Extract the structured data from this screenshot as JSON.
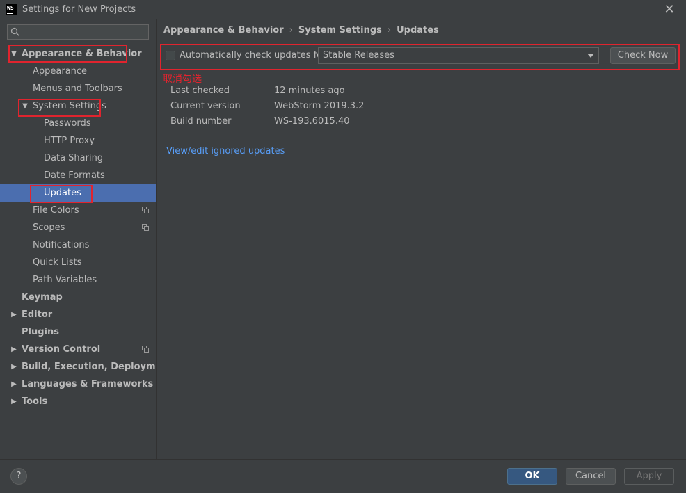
{
  "window": {
    "title": "Settings for New Projects",
    "app_logo": "WS"
  },
  "search": {
    "placeholder": "",
    "value": ""
  },
  "sidebar": {
    "appearance_behavior": "Appearance & Behavior",
    "appearance": "Appearance",
    "menus_toolbars": "Menus and Toolbars",
    "system_settings": "System Settings",
    "passwords": "Passwords",
    "http_proxy": "HTTP Proxy",
    "data_sharing": "Data Sharing",
    "date_formats": "Date Formats",
    "updates": "Updates",
    "file_colors": "File Colors",
    "scopes": "Scopes",
    "notifications": "Notifications",
    "quick_lists": "Quick Lists",
    "path_variables": "Path Variables",
    "keymap": "Keymap",
    "editor": "Editor",
    "plugins": "Plugins",
    "version_control": "Version Control",
    "build": "Build, Execution, Deployment",
    "languages": "Languages & Frameworks",
    "tools": "Tools"
  },
  "breadcrumb": {
    "first": "Appearance & Behavior",
    "second": "System Settings",
    "third": "Updates",
    "sep": "›"
  },
  "updates": {
    "auto_check_label": "Automatically check updates for",
    "auto_check_checked": false,
    "channel": "Stable Releases",
    "check_now": "Check Now",
    "annotation": "取消勾选",
    "last_checked_label": "Last checked",
    "last_checked_value": "12 minutes ago",
    "current_version_label": "Current version",
    "current_version_value": "WebStorm 2019.3.2",
    "build_number_label": "Build number",
    "build_number_value": "WS-193.6015.40",
    "ignored_link": "View/edit ignored updates"
  },
  "footer": {
    "help": "?",
    "ok": "OK",
    "cancel": "Cancel",
    "apply": "Apply"
  },
  "colors": {
    "background": "#3c3f41",
    "selection": "#4b6eaf",
    "link": "#589df6",
    "highlight_box": "#e0242e",
    "ok_button": "#365880"
  }
}
